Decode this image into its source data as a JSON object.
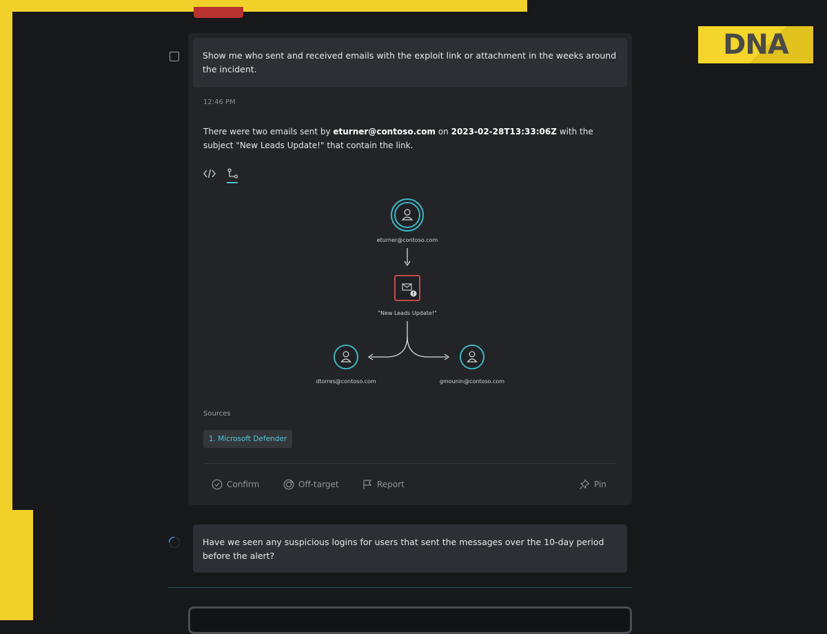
{
  "logo": {
    "text": "DNA"
  },
  "colors": {
    "frame": "#f1d02a",
    "accent": "#4ec3d3",
    "alert": "#c44b4b",
    "background": "#17181a",
    "card": "#222427"
  },
  "conversation": {
    "prompt1": "Show me who sent and received emails with the exploit link or attachment in the weeks around the incident.",
    "timestamp": "12:46 PM",
    "answer": {
      "part1": "There were two emails sent by ",
      "sender": "eturner@contoso.com",
      "part2": " on ",
      "datetime": "2023-02-28T13:33:06Z",
      "part3": " with the subject \"New Leads Update!\" that contain the link."
    },
    "view_toggle": {
      "code_icon": "code-icon",
      "graph_icon": "graph-icon"
    },
    "graph": {
      "sender": "eturner@contoso.com",
      "email_subject": "\"New Leads Update!\"",
      "recipients": [
        "dtorres@contoso.com",
        "gmounin@contoso.com"
      ]
    },
    "sources": {
      "label": "Sources",
      "items": [
        "1. Microsoft Defender"
      ]
    },
    "actions": {
      "confirm": "Confirm",
      "off_target": "Off-target",
      "report": "Report",
      "pin": "Pin"
    },
    "prompt2": "Have we seen any suspicious logins for users that sent the messages over the 10-day period before the alert?"
  }
}
